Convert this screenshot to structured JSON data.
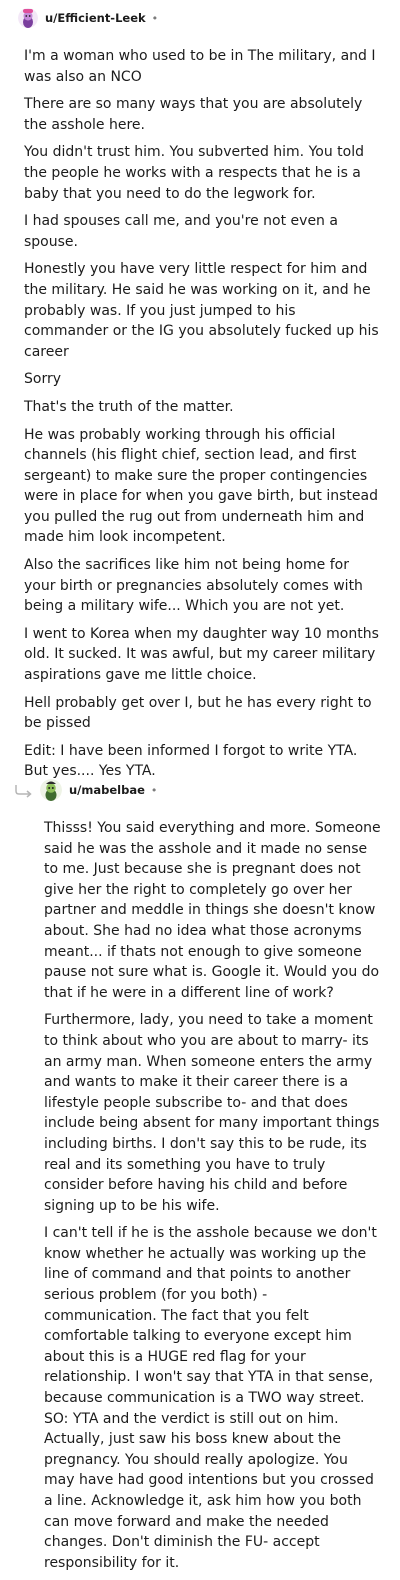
{
  "comments": [
    {
      "username": "u/Efficient-Leek",
      "separator": "•",
      "avatar_icon": "purple-snoo-avatar-icon",
      "paragraphs": [
        "I'm a woman who used to be in The military, and I was also an NCO",
        "There are so many ways that you are absolutely the asshole here.",
        "You didn't trust him. You subverted him. You told the people he works with a respects that he is a baby that you need to do the legwork for.",
        "I had spouses call me, and you're not even a spouse.",
        "Honestly you have very little respect for him and the military. He said he was working on it, and he probably was. If you just jumped to his commander or the IG you absolutely fucked up his career",
        "Sorry",
        "That's the truth of the matter.",
        "He was probably working through his official channels (his flight chief, section lead, and first sergeant) to make sure the proper contingencies were in place for when you gave birth, but instead you pulled the rug out from underneath him and made him look incompetent.",
        "Also the sacrifices like him not being home for your birth or pregnancies absolutely comes with being a military wife... Which you are not yet.",
        "I went to Korea when my daughter way 10 months old. It sucked. It was awful, but my career military aspirations gave me little choice.",
        "Hell probably get over I, but he has every right to be pissed",
        "Edit: I have been informed I forgot to write YTA. But yes.... Yes YTA."
      ]
    },
    {
      "username": "u/mabelbae",
      "separator": "•",
      "avatar_icon": "green-snoo-avatar-icon",
      "reply_icon": "reply-arrow-icon",
      "paragraphs": [
        "Thisss! You said everything and more. Someone said he was the asshole and it made no sense to me. Just because she is pregnant does not give her the right to completely go over her partner and meddle in things she doesn't know about. She had no idea what those acronyms meant... if thats not enough to give someone pause not sure what is. Google it. Would you do that if he were in a different line of work?",
        "Furthermore, lady, you need to take a moment to think about who you are about to marry- its an army man. When someone enters the army and wants to make it their career there is a lifestyle people subscribe to- and that does include being absent for many important things including births. I don't say this to be rude, its real and its something you have to truly consider before having his child and before signing up to be his wife.",
        "I can't tell if he is the asshole because we don't know whether he actually was working up the line of command and that points to another serious problem (for you both) - communication. The fact that you felt comfortable talking to everyone except him about this is a HUGE red flag for your relationship. I won't say that YTA in that sense, because communication is a TWO way street. SO: YTA and the verdict is still out on him. Actually, just saw his boss knew about the pregnancy. You should really apologize. You may have had good intentions but you crossed a line. Acknowledge it, ask him how you both can move forward and make the needed changes. Don't diminish the FU- accept responsibility for it."
      ]
    }
  ],
  "colors": {
    "text": "#1c1c1c",
    "meta": "#7c7c7c",
    "background": "#ffffff"
  }
}
